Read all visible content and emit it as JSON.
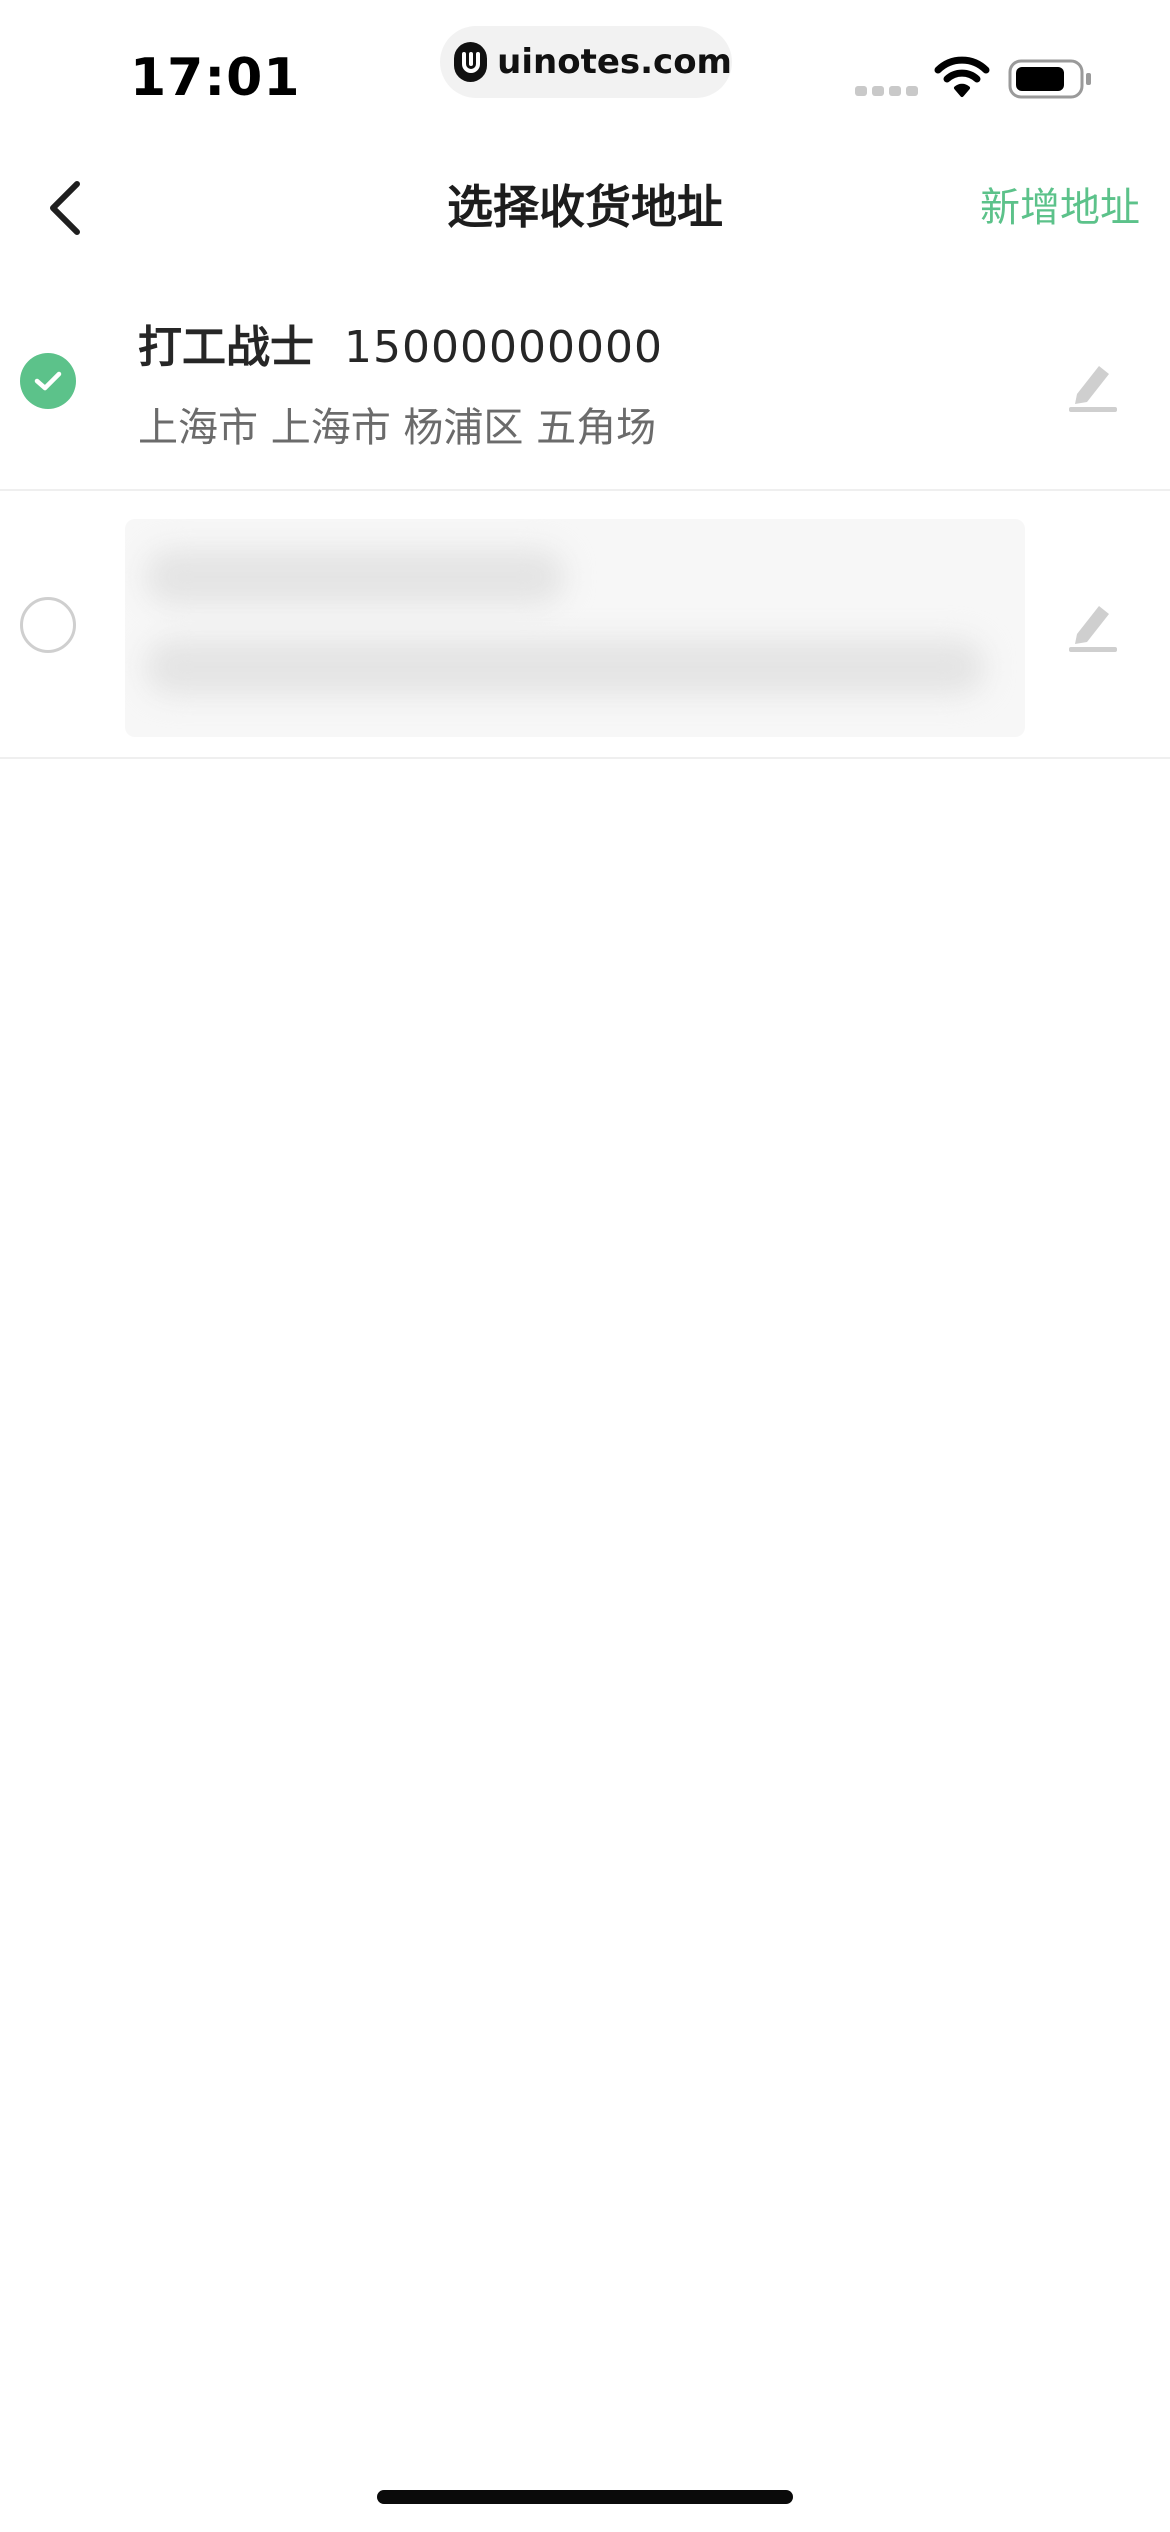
{
  "status_bar": {
    "time": "17:01",
    "url": "uinotes.com",
    "icons": [
      "signal-icon",
      "wifi-icon",
      "battery-icon"
    ]
  },
  "nav": {
    "back_icon": "chevron-left-icon",
    "title": "选择收货地址",
    "add_label": "新增地址"
  },
  "addresses": [
    {
      "name": "打工战士",
      "phone": "15000000000",
      "address": "上海市 上海市 杨浦区 五角场",
      "selected": true
    },
    {
      "name": "",
      "phone": "",
      "address": "",
      "selected": false,
      "blurred": true
    }
  ],
  "colors": {
    "accent": "#5cc28a",
    "title": "#1d1d1d",
    "secondary_text": "#6b6b6b",
    "divider": "#efefef",
    "edit_icon": "#cfcfcf"
  }
}
